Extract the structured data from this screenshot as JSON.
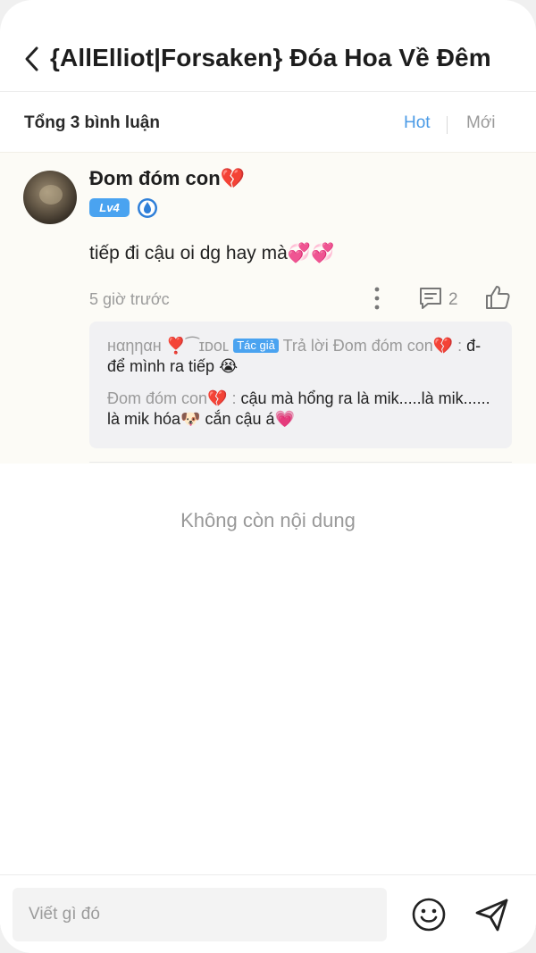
{
  "header": {
    "title": "{AllElliot|Forsaken} Đóa Hoa Về Đêm",
    "back_icon": "chevron-left-icon"
  },
  "sortbar": {
    "total": "Tổng 3 bình luận",
    "tab_hot": "Hot",
    "tab_new": "Mới",
    "active_color": "#4b9be6"
  },
  "comment": {
    "username": "Đom đóm con💔",
    "level": "Lv4",
    "text": "tiếp đi cậu oi dg hay mà💞💞",
    "time": "5 giờ trước",
    "reply_count": "2",
    "replies": [
      {
        "author": "нαηηαн ❣️⁀ɪᴅᴏʟ",
        "tag": "Tác giả",
        "reply_to": "Trả lời Đom đóm con💔 :",
        "text": "đ-để mình ra tiếp 😭"
      },
      {
        "author": "Đom đóm con💔 :",
        "text": "cậu mà hổng ra là mik.....là mik...... là mik hóa🐶 cắn cậu á💗"
      }
    ]
  },
  "empty_text": "Không còn nội dung",
  "composer": {
    "placeholder": "Viết gì đó",
    "emoji_icon": "smiley-icon",
    "send_icon": "send-icon"
  },
  "colors": {
    "accent": "#4aa3f0",
    "comment_bg": "#fcfbf6",
    "muted": "#9b9b9b"
  }
}
